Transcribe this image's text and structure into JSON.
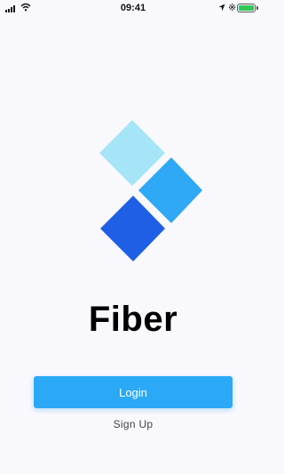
{
  "status_bar": {
    "time": "09:41",
    "battery_level": 1.0,
    "icons": [
      "signal-icon",
      "wifi-icon",
      "location-icon",
      "bluetooth-icon",
      "battery-icon"
    ]
  },
  "app": {
    "name": "Fiber",
    "logo_colors": [
      "#a6e4f8",
      "#2fa8f5",
      "#1f5fe6"
    ]
  },
  "actions": {
    "login_label": "Login",
    "signup_label": "Sign Up"
  },
  "colors": {
    "primary": "#2ba9f6",
    "background": "#f9f8fd"
  }
}
